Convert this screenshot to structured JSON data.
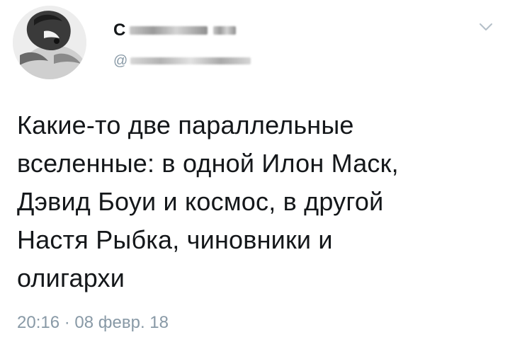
{
  "tweet": {
    "display_name": "С",
    "handle_prefix": "@",
    "menu_icon": "chevron-down-icon",
    "text_lines": [
      "Какие-то две параллельные",
      "вселенные: в одной Илон Маск,",
      "Дэвид Боуи и космос, в другой",
      "Настя Рыбка, чиновники и",
      "олигархи"
    ],
    "timestamp": "20:16 · 08 февр. 18"
  },
  "colors": {
    "text": "#14171a",
    "secondary": "#8899a6",
    "background": "#ffffff"
  }
}
